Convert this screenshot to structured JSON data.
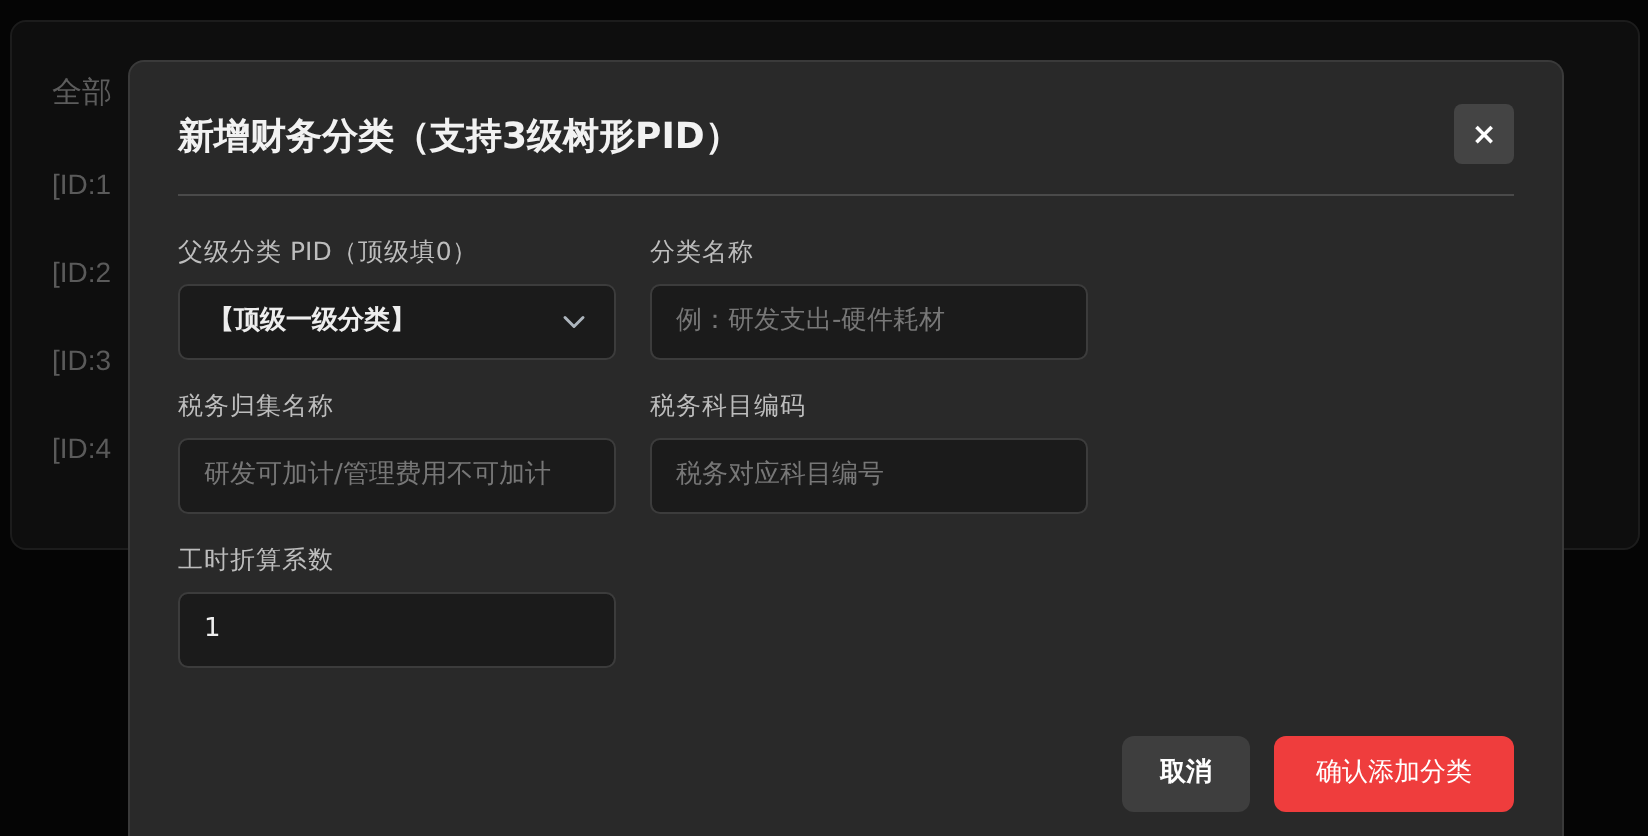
{
  "background": {
    "title": "全部",
    "items": [
      "[ID:1",
      "[ID:2",
      "[ID:3",
      "[ID:4"
    ]
  },
  "modal": {
    "title": "新增财务分类（支持3级树形PID）",
    "close": "×",
    "fields": [
      {
        "kind": "select",
        "label": "父级分类 PID（顶级填0）",
        "value": "【顶级一级分类】"
      },
      {
        "kind": "input",
        "label": "分类名称",
        "placeholder": "例：研发支出-硬件耗材"
      },
      {
        "kind": "input",
        "label": "税务归集名称",
        "placeholder": "研发可加计/管理费用不可加计"
      },
      {
        "kind": "input",
        "label": "税务科目编码",
        "placeholder": "税务对应科目编号"
      },
      {
        "kind": "input",
        "label": "工时折算系数",
        "value": "1"
      }
    ],
    "buttons": [
      {
        "kind": "secondary",
        "label": "取消"
      },
      {
        "kind": "primary",
        "label": "确认添加分类"
      }
    ]
  }
}
